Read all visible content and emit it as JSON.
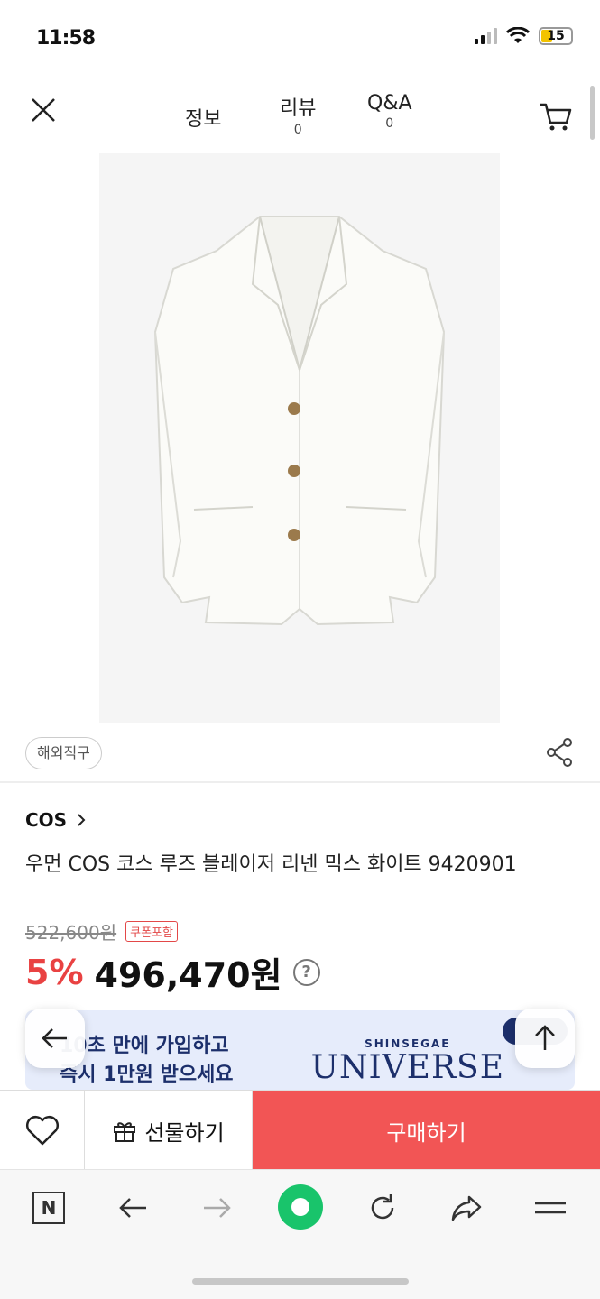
{
  "status": {
    "time": "11:58",
    "battery": "15"
  },
  "topnav": {
    "tabs": [
      {
        "label": "정보",
        "count": ""
      },
      {
        "label": "리뷰",
        "count": "0"
      },
      {
        "label": "Q&A",
        "count": "0"
      }
    ]
  },
  "product": {
    "badge": "해외직구",
    "brand": "COS",
    "title": "우먼 COS 코스 루즈 블레이저 리넨 믹스 화이트 9420901",
    "original_price": "522,600원",
    "coupon_tag": "쿠폰포함",
    "discount": "5%",
    "price": "496,470원",
    "help_icon": "?"
  },
  "banner": {
    "line1": "10초 만에 가입하고",
    "line2": "즉시 1만원 받으세요",
    "brand_small": "SHINSEGAE",
    "brand_large": "UNIVERSE"
  },
  "buybar": {
    "gift_label": "선물하기",
    "buy_label": "구매하기"
  },
  "browser": {
    "n_label": "N"
  },
  "colors": {
    "accent_red": "#f25555",
    "discount_red": "#e94242",
    "banner_blue": "#e6ecfb",
    "naver_green": "#19c46b"
  }
}
